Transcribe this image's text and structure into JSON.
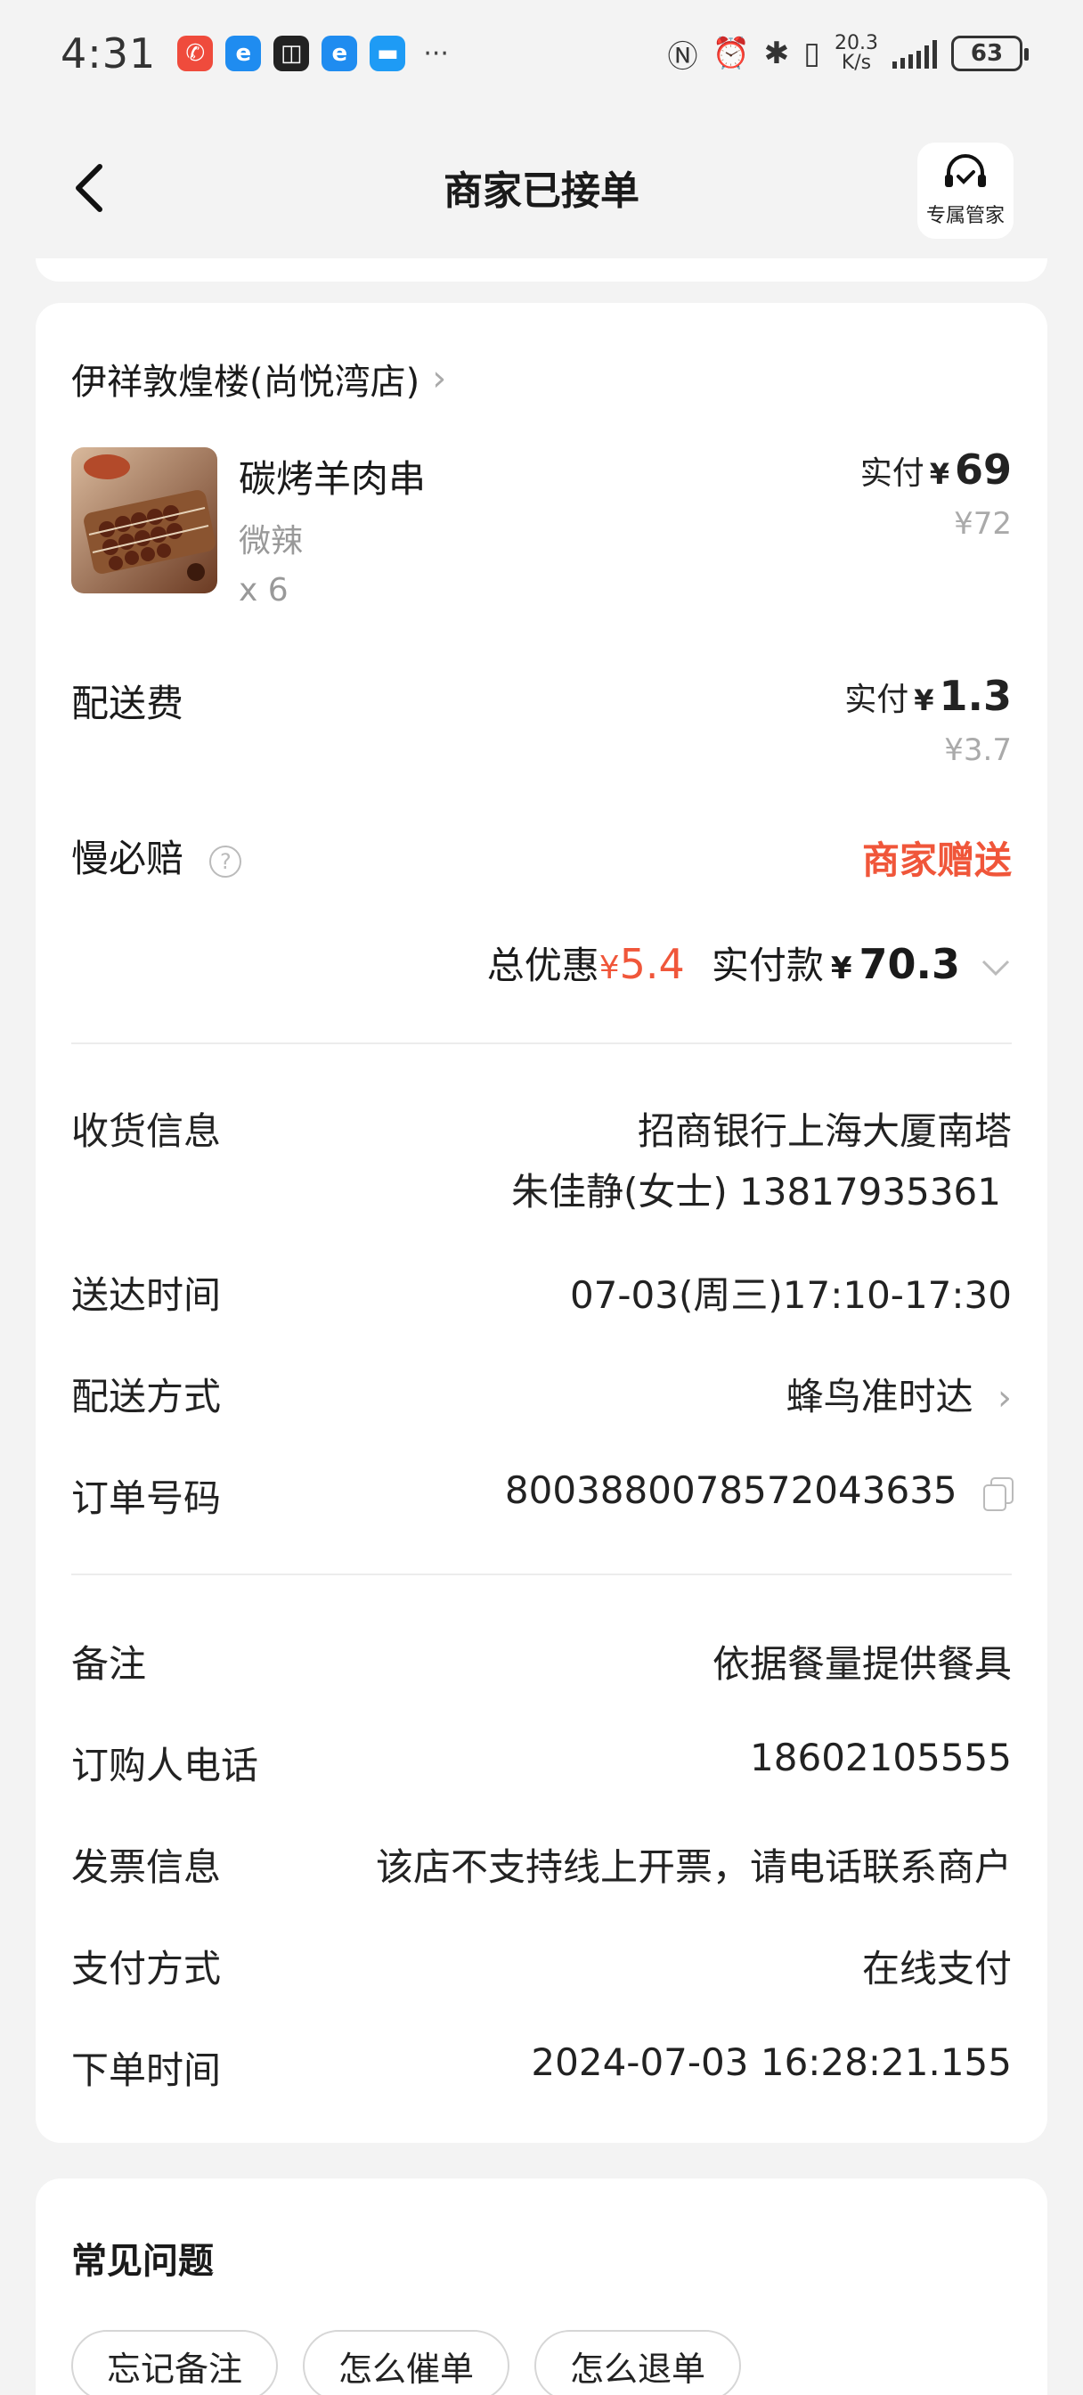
{
  "status_bar": {
    "time": "4:31",
    "more": "···",
    "speed_value": "20.3",
    "speed_unit": "K/s",
    "battery": "63",
    "icons": [
      "missed-call-app-icon",
      "browser-app-icon",
      "notes-app-icon",
      "browser-app-icon",
      "message-app-icon",
      "nfc-icon",
      "alarm-icon",
      "bluetooth-icon",
      "vibrate-icon",
      "signal-icon",
      "battery-icon"
    ]
  },
  "header": {
    "title": "商家已接单",
    "service_label": "专属管家"
  },
  "order": {
    "shop_name": "伊祥敦煌楼(尚悦湾店)",
    "item": {
      "name": "碳烤羊肉串",
      "spec": "微辣",
      "qty": "x 6",
      "pay_label": "实付",
      "yen": "¥",
      "pay_amount": "69",
      "original": "¥72"
    },
    "delivery_fee": {
      "label": "配送费",
      "pay_label": "实付",
      "yen": "¥",
      "pay_amount": "1.3",
      "original": "¥3.7"
    },
    "late_comp": {
      "label": "慢必赔",
      "help": "?",
      "value": "商家赠送"
    },
    "summary": {
      "discount_label": "总优惠",
      "discount_yen": "¥",
      "discount_amount": "5.4",
      "total_label": "实付款",
      "total_yen": "¥",
      "total_amount": "70.3"
    }
  },
  "info": {
    "receiver_label": "收货信息",
    "receiver_address": "招商银行上海大厦南塔",
    "receiver_contact": "朱佳静(女士) 13817935361",
    "delivery_time_label": "送达时间",
    "delivery_time": "07-03(周三)17:10-17:30",
    "delivery_method_label": "配送方式",
    "delivery_method": "蜂鸟准时达",
    "order_no_label": "订单号码",
    "order_no": "8003880078572043635",
    "remark_label": "备注",
    "remark": "依据餐量提供餐具",
    "buyer_phone_label": "订购人电话",
    "buyer_phone": "18602105555",
    "invoice_label": "发票信息",
    "invoice": "该店不支持线上开票，请电话联系商户",
    "payment_label": "支付方式",
    "payment": "在线支付",
    "order_time_label": "下单时间",
    "order_time": "2024-07-03 16:28:21.155"
  },
  "faq": {
    "title": "常见问题",
    "tags": [
      "忘记备注",
      "怎么催单",
      "怎么退单"
    ]
  },
  "colors": {
    "accent": "#f0563a",
    "background": "#f3f3f3",
    "card": "#ffffff"
  }
}
